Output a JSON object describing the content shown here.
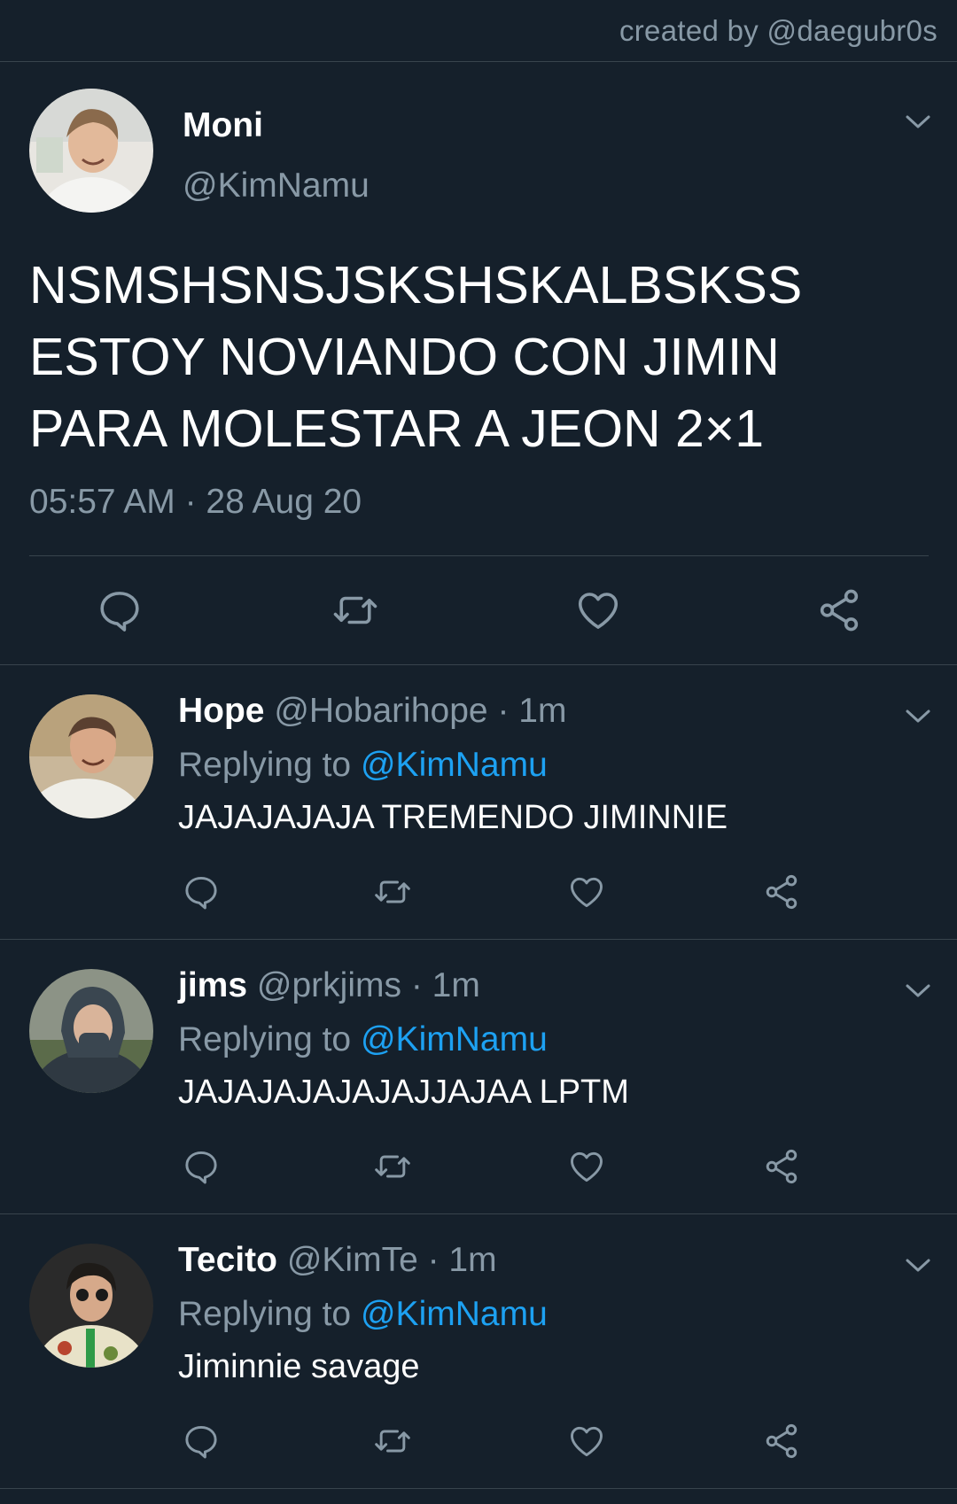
{
  "credit": "created by @daegubr0s",
  "main_tweet": {
    "name": "Moni",
    "handle": "@KimNamu",
    "text": "NSMSHSNSJSKSHSKALBSKSS\nESTOY NOVIANDO CON JIMIN\nPARA MOLESTAR A JEON 2×1",
    "timestamp": "05:57 AM · 28 Aug 20"
  },
  "replies": [
    {
      "name": "Hope",
      "handle": "@Hobarihope",
      "time": "· 1m",
      "replying_prefix": "Replying to",
      "replying_to": "@KimNamu",
      "text": "JAJAJAJAJA TREMENDO JIMINNIE"
    },
    {
      "name": "jims",
      "handle": "@prkjims",
      "time": "· 1m",
      "replying_prefix": "Replying to",
      "replying_to": "@KimNamu",
      "text": "JAJAJAJAJAJAJJAJAA LPTM"
    },
    {
      "name": "Tecito",
      "handle": "@KimTe",
      "time": "· 1m",
      "replying_prefix": "Replying to",
      "replying_to": "@KimNamu",
      "text": "Jiminnie savage"
    }
  ],
  "icons": {
    "reply": "reply-icon",
    "retweet": "retweet-icon",
    "like": "heart-icon",
    "share": "share-icon",
    "more": "chevron-down-icon"
  },
  "colors": {
    "background": "#15202b",
    "divider": "#38444d",
    "secondary_text": "#8899a6",
    "primary_text": "#ffffff",
    "link": "#1da1f2"
  }
}
